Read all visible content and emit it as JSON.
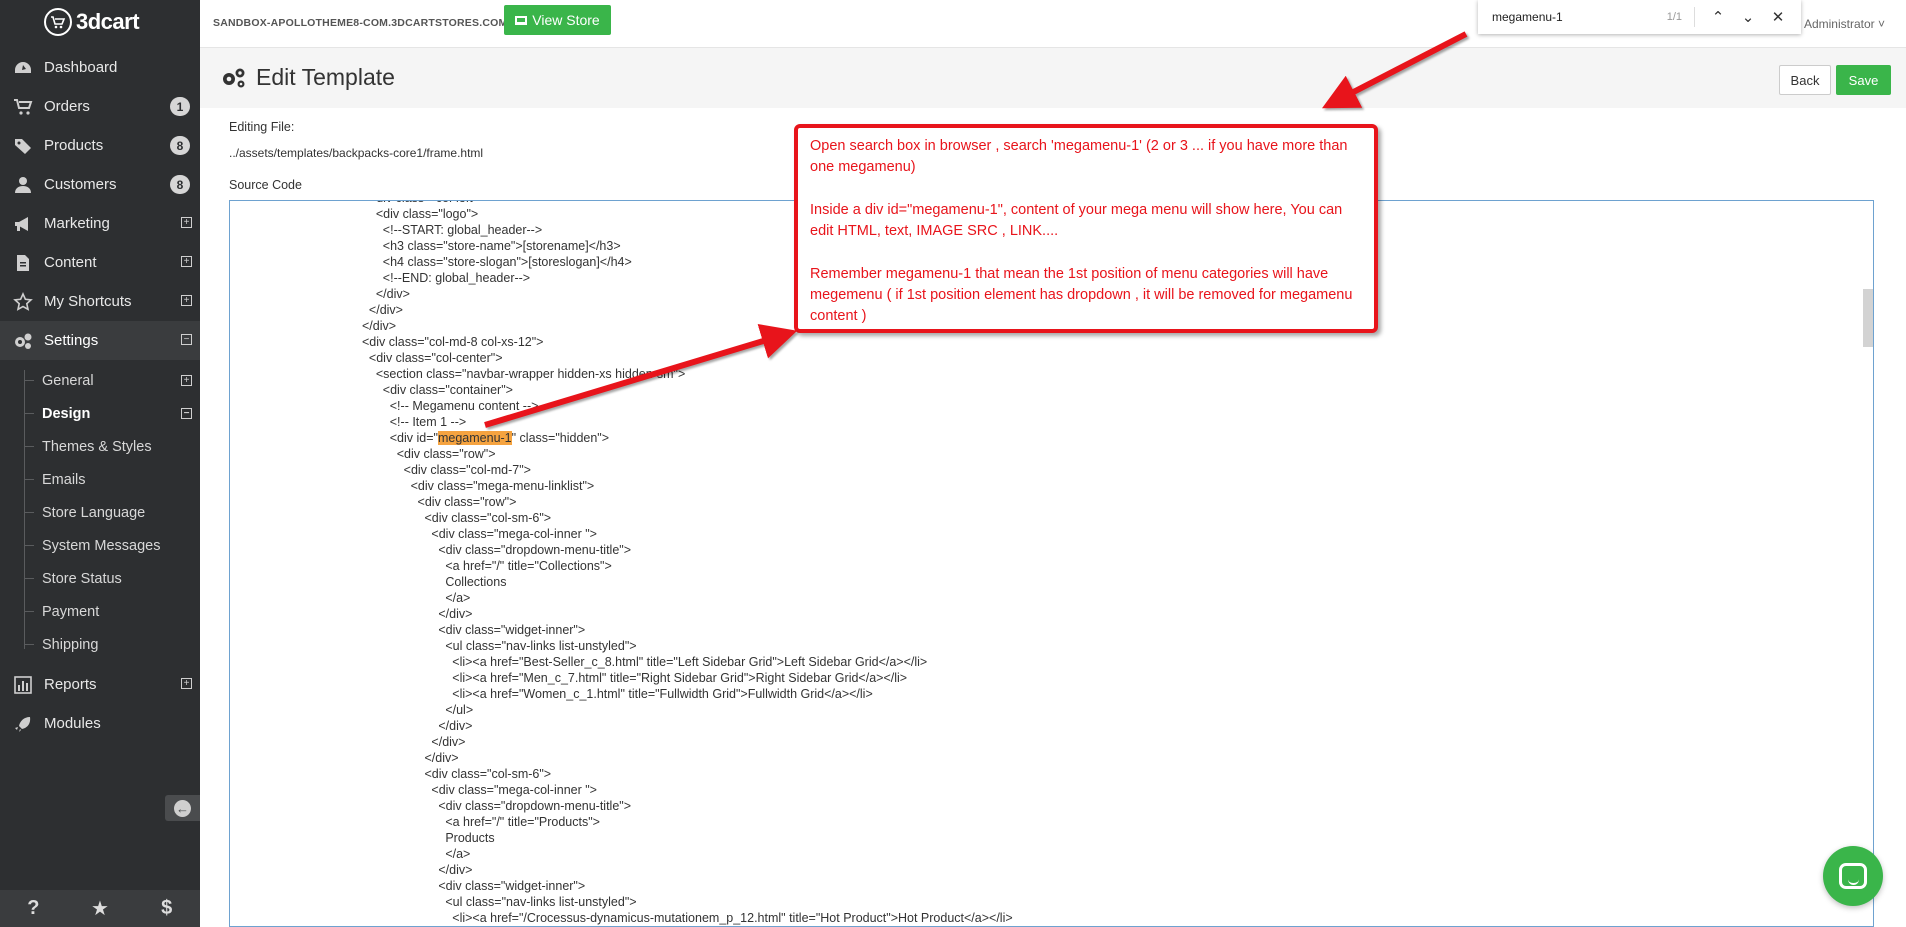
{
  "app": {
    "logo_text": "3dcart"
  },
  "topbar": {
    "store_url": "SANDBOX-APOLLOTHEME8-COM.3DCARTSTORES.COM",
    "view_store_label": "View Store",
    "admin_label": "Administrator ˅"
  },
  "findbar": {
    "query": "megamenu-1",
    "count": "1/1"
  },
  "sidebar": {
    "items": [
      {
        "label": "Dashboard",
        "icon": "dashboard-icon"
      },
      {
        "label": "Orders",
        "badge": "1",
        "icon": "cart-icon"
      },
      {
        "label": "Products",
        "badge": "8",
        "icon": "tags-icon"
      },
      {
        "label": "Customers",
        "badge": "8",
        "icon": "user-icon"
      },
      {
        "label": "Marketing",
        "toggle": "+",
        "icon": "megaphone-icon"
      },
      {
        "label": "Content",
        "toggle": "+",
        "icon": "document-icon"
      },
      {
        "label": "My Shortcuts",
        "toggle": "+",
        "icon": "star-icon"
      },
      {
        "label": "Settings",
        "toggle": "−",
        "icon": "gears-icon"
      }
    ],
    "settings_sub": [
      {
        "label": "General",
        "toggle": "+"
      },
      {
        "label": "Design",
        "toggle": "−"
      },
      {
        "label": "Themes & Styles"
      },
      {
        "label": "Emails"
      },
      {
        "label": "Store Language"
      },
      {
        "label": "System Messages"
      },
      {
        "label": "Store Status"
      },
      {
        "label": "Payment"
      },
      {
        "label": "Shipping"
      }
    ],
    "bottom_items": [
      {
        "label": "Reports",
        "toggle": "+",
        "icon": "chart-icon"
      },
      {
        "label": "Modules",
        "icon": "rocket-icon"
      }
    ],
    "footer": [
      "?",
      "★",
      "$"
    ]
  },
  "page": {
    "title": "Edit Template",
    "back_label": "Back",
    "save_label": "Save",
    "editing_label": "Editing File:",
    "file_path": "../assets/templates/backpacks-core1/frame.html",
    "source_label": "Source Code"
  },
  "code_lines": [
    "        <div class=\"col-left\">",
    "          <div class=\"logo\">",
    "            <!--START: global_header-->",
    "            <h3 class=\"store-name\">[storename]</h3>",
    "            <h4 class=\"store-slogan\">[storeslogan]</h4>",
    "            <!--END: global_header-->",
    "          </div>",
    "        </div>",
    "      </div>",
    "      <div class=\"col-md-8 col-xs-12\">",
    "        <div class=\"col-center\">",
    "          <section class=\"navbar-wrapper hidden-xs hidden-sm\">",
    "            <div class=\"container\">",
    "              <!-- Megamenu content -->",
    "              <!-- Item 1 -->",
    "              <div id=\"megamenu-1\" class=\"hidden\">",
    "                <div class=\"row\">",
    "                  <div class=\"col-md-7\">",
    "                    <div class=\"mega-menu-linklist\">",
    "                      <div class=\"row\">",
    "                        <div class=\"col-sm-6\">",
    "                          <div class=\"mega-col-inner \">",
    "                            <div class=\"dropdown-menu-title\">",
    "                              <a href=\"/\" title=\"Collections\">",
    "                              Collections",
    "                              </a>",
    "                            </div>",
    "                            <div class=\"widget-inner\">",
    "                              <ul class=\"nav-links list-unstyled\">",
    "                                <li><a href=\"Best-Seller_c_8.html\" title=\"Left Sidebar Grid\">Left Sidebar Grid</a></li>",
    "                                <li><a href=\"Men_c_7.html\" title=\"Right Sidebar Grid\">Right Sidebar Grid</a></li>",
    "                                <li><a href=\"Women_c_1.html\" title=\"Fullwidth Grid\">Fullwidth Grid</a></li>",
    "                              </ul>",
    "                            </div>",
    "                          </div>",
    "                        </div>",
    "                        <div class=\"col-sm-6\">",
    "                          <div class=\"mega-col-inner \">",
    "                            <div class=\"dropdown-menu-title\">",
    "                              <a href=\"/\" title=\"Products\">",
    "                              Products",
    "                              </a>",
    "                            </div>",
    "                            <div class=\"widget-inner\">",
    "                              <ul class=\"nav-links list-unstyled\">",
    "                                <li><a href=\"/Crocessus-dynamicus-mutationem_p_12.html\" title=\"Hot Product\">Hot Product</a></li>"
  ],
  "code_highlight": {
    "line": 15,
    "term": "megamenu-1"
  },
  "annotation": {
    "paragraphs": [
      "Open search box in browser , search 'megamenu-1' (2 or 3 ... if you have more than one megamenu)",
      "Inside a div id=\"megamenu-1\", content of your mega menu will show here, You can edit HTML, text, IMAGE SRC , LINK....",
      "Remember megamenu-1 that mean the 1st position of menu categories will have megemenu ( if 1st position element has dropdown , it will be removed for megamenu content )"
    ],
    "color": "#e8141b"
  },
  "colors": {
    "sidebar_bg": "#2d2f31",
    "accent_green": "#3ab54a",
    "find_highlight": "#f5a340"
  }
}
